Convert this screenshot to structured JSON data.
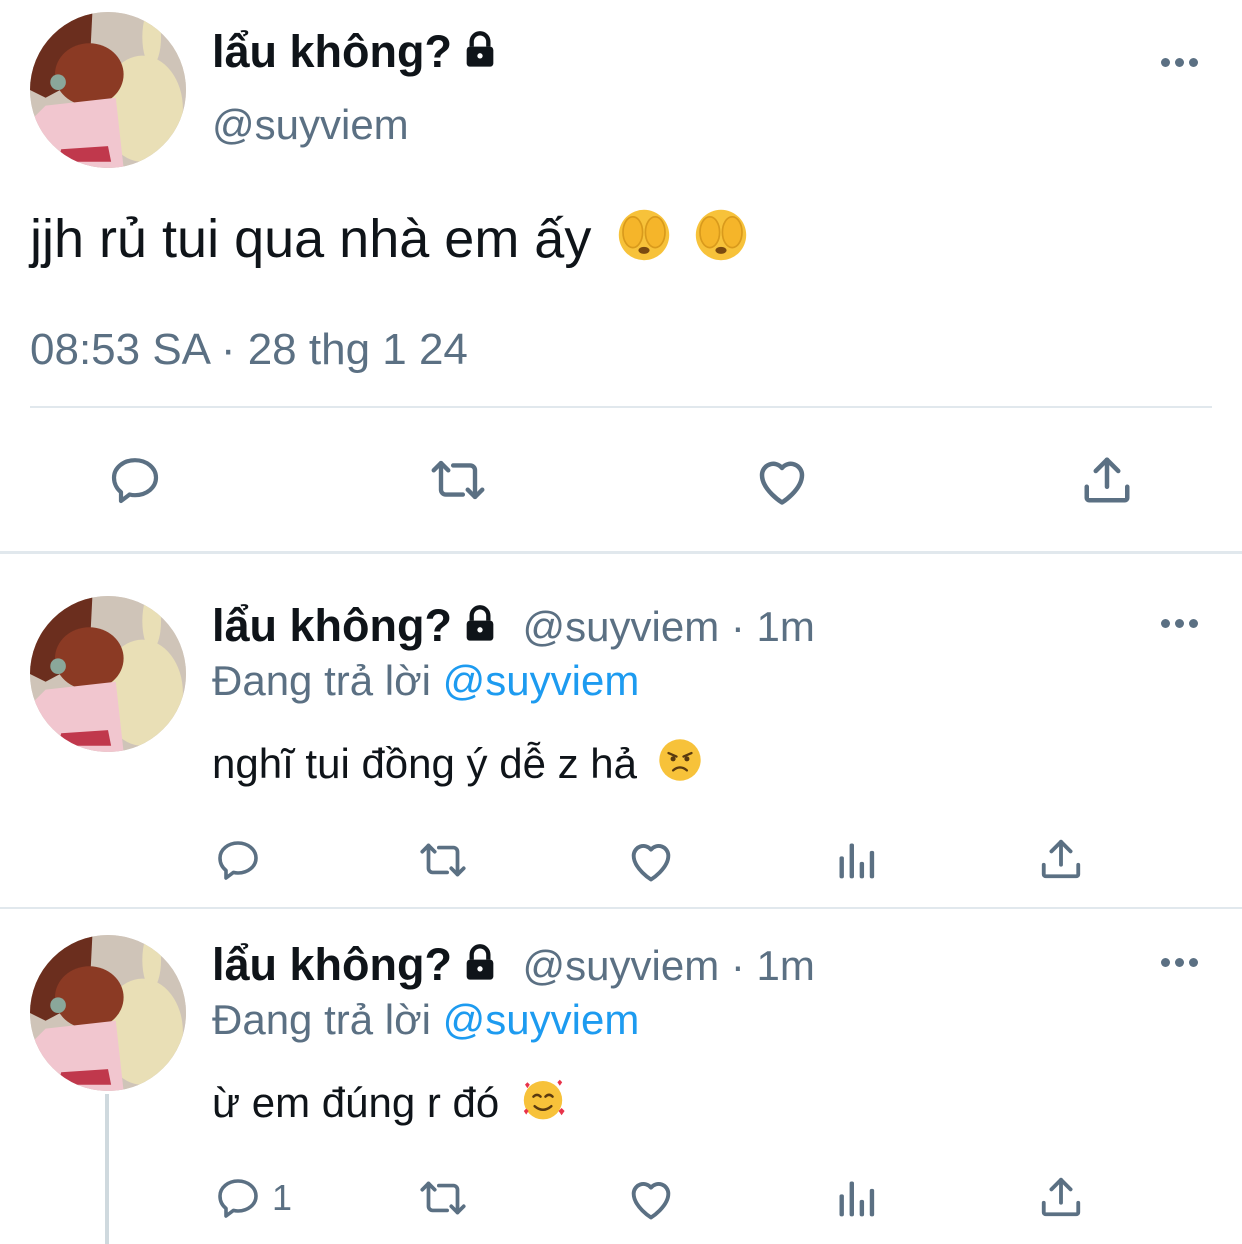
{
  "main_tweet": {
    "display_name": "lẩu không?",
    "handle": "@suyviem",
    "text": "jjh rủ tui qua nhà em ấy",
    "timestamp": "08:53 SA · 28 thg 1 24",
    "emojis": [
      "see-no-evil-face",
      "see-no-evil-face"
    ]
  },
  "replies": [
    {
      "display_name": "lẩu không?",
      "handle_time": "@suyviem · 1m",
      "replying_prefix": "Đang trả lời",
      "replying_to": "@suyviem",
      "text": "nghĩ tui đồng ý dễ z hả",
      "emoji": "angry-face",
      "reply_count": ""
    },
    {
      "display_name": "lẩu không?",
      "handle_time": "@suyviem · 1m",
      "replying_prefix": "Đang trả lời",
      "replying_to": "@suyviem",
      "text": "ừ em đúng r đó",
      "emoji": "smiling-face-with-hearts",
      "reply_count": "1"
    }
  ],
  "colors": {
    "text": "#0f1419",
    "muted": "#5b7083",
    "link": "#1d9bf0",
    "divider": "#e1e8ed"
  }
}
